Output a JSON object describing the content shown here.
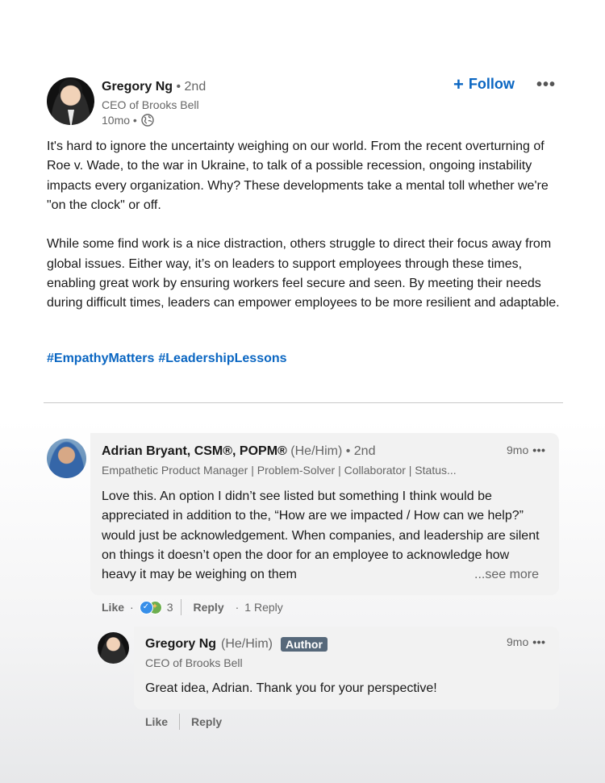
{
  "post": {
    "author": {
      "name": "Gregory Ng",
      "degree": "• 2nd",
      "headline": "CEO of Brooks Bell",
      "time": "10mo •"
    },
    "follow_label": "Follow",
    "body": [
      "It's hard to ignore the uncertainty weighing on our world. From the recent overturning of Roe v. Wade, to the war in Ukraine, to talk of a possible recession, ongoing instability impacts every organization. Why? These developments take a mental toll whether we're \"on the clock\" or off.",
      "While some find work is a nice distraction, others struggle to direct their focus away from global issues. Either way, it’s on leaders to support employees through these times, enabling great work by ensuring workers feel secure and seen. By meeting their needs during difficult times, leaders can empower employees to be more resilient and adaptable."
    ],
    "hashtags": [
      "#EmpathyMatters",
      "#LeadershipLessons"
    ]
  },
  "comment": {
    "name": "Adrian Bryant, CSM®, POPM®",
    "pronouns": "(He/Him)",
    "degree": "• 2nd",
    "headline": "Empathetic Product Manager | Problem-Solver | Collaborator | Status...",
    "time": "9mo",
    "text": "Love this. An option I didn’t see listed but something I think would be appreciated in addition to the, “How are we impacted / How can we help?” would just be acknowledgement. When companies, and leadership are silent on things it doesn’t open the door for an employee to acknowledge how heavy it may be weighing on them",
    "see_more": "...see more",
    "actions": {
      "like": "Like",
      "reaction_count": "3",
      "reply": "Reply",
      "replies": "1 Reply"
    }
  },
  "reply": {
    "name": "Gregory Ng",
    "pronouns": "(He/Him)",
    "badge": "Author",
    "headline": "CEO of Brooks Bell",
    "time": "9mo",
    "text": "Great idea, Adrian. Thank you for your perspective!",
    "actions": {
      "like": "Like",
      "reply": "Reply"
    }
  },
  "colors": {
    "link": "#0a66c2",
    "muted": "#666666",
    "bubble": "#f2f2f2",
    "badge": "#56687a"
  }
}
